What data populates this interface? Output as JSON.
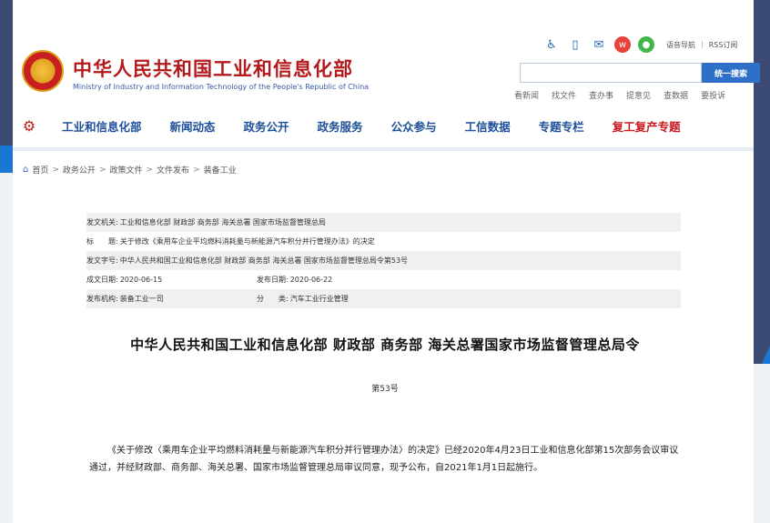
{
  "header": {
    "site_title": "中华人民共和国工业和信息化部",
    "site_subtitle": "Ministry of Industry and Information Technology of the People's Republic of China",
    "top_links": [
      "语音导航",
      "RSS订阅"
    ],
    "search_button": "统一搜索",
    "search_placeholder": "",
    "quick_links": [
      "看新闻",
      "找文件",
      "查办事",
      "提意见",
      "查数据",
      "要投诉"
    ]
  },
  "nav": {
    "items": [
      "工业和信息化部",
      "新闻动态",
      "政务公开",
      "政务服务",
      "公众参与",
      "工信数据",
      "专题专栏"
    ],
    "highlight": "复工复产专题"
  },
  "breadcrumb": [
    "首页",
    "政务公开",
    "政策文件",
    "文件发布",
    "装备工业"
  ],
  "meta": {
    "issuer_label": "发文机关:",
    "issuer": "工业和信息化部 财政部 商务部 海关总署 国家市场监督管理总局",
    "title_label": "标　　题:",
    "title": "关于修改《乘用车企业平均燃料消耗量与新能源汽车积分并行管理办法》的决定",
    "doc_no_label": "发文字号:",
    "doc_no": "中华人民共和国工业和信息化部 财政部 商务部 海关总署 国家市场监督管理总局令第53号",
    "written_label": "成文日期:",
    "written": "2020-06-15",
    "published_label": "发布日期:",
    "published": "2020-06-22",
    "org_label": "发布机构:",
    "org": "装备工业一司",
    "category_label": "分　　类:",
    "category": "汽车工业行业管理"
  },
  "article": {
    "title": "中华人民共和国工业和信息化部 财政部 商务部 海关总署国家市场监督管理总局令",
    "number": "第53号",
    "body": "《关于修改〈乘用车企业平均燃料消耗量与新能源汽车积分并行管理办法〉的决定》已经2020年4月23日工业和信息化部第15次部务会议审议通过，并经财政部、商务部、海关总署、国家市场监督管理总局审议同意，现予公布，自2021年1月1日起施行。"
  },
  "colors": {
    "brand_red": "#b4191c",
    "nav_blue": "#1e4f9a",
    "search_blue": "#2f6fc7"
  }
}
